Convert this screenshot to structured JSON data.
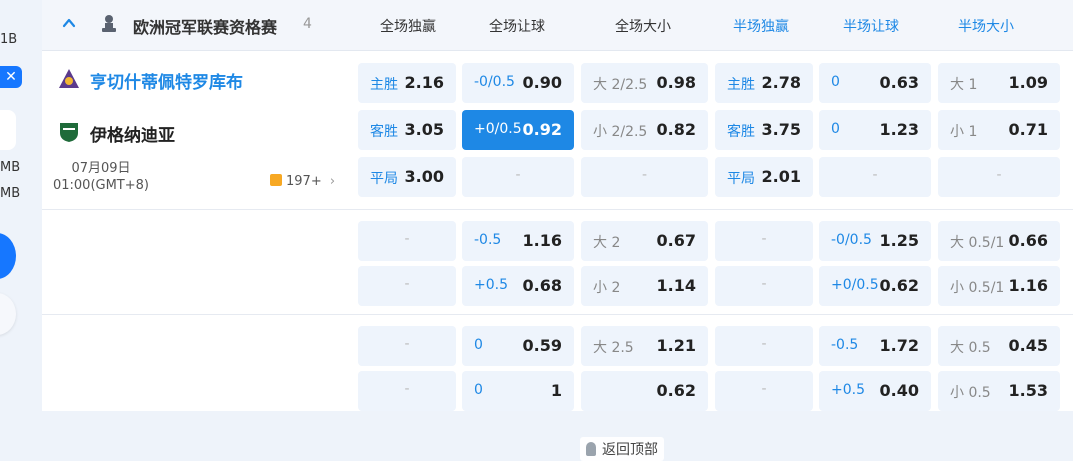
{
  "sidebar_fragments": [
    "1B",
    "MB",
    "MB"
  ],
  "header": {
    "league": "欧洲冠军联赛资格赛",
    "count": "4",
    "columns": [
      "全场独赢",
      "全场让球",
      "全场大小",
      "半场独赢",
      "半场让球",
      "半场大小"
    ]
  },
  "match": {
    "home": "亨切什蒂佩特罗库布",
    "away": "伊格纳迪亚",
    "date": "07月09日",
    "time": "01:00(GMT+8)",
    "more": "197+"
  },
  "rows": [
    [
      {
        "label": "主胜",
        "value": "2.16"
      },
      {
        "label": "-0/0.5",
        "value": "0.90"
      },
      {
        "label": "大 2/2.5",
        "value": "0.98",
        "grey": true
      },
      {
        "label": "主胜",
        "value": "2.78"
      },
      {
        "label": "0",
        "value": "0.63"
      },
      {
        "label": "大 1",
        "value": "1.09",
        "grey": true
      }
    ],
    [
      {
        "label": "客胜",
        "value": "3.05"
      },
      {
        "label": "+0/0.5",
        "value": "0.92",
        "highlight": true
      },
      {
        "label": "小 2/2.5",
        "value": "0.82",
        "grey": true
      },
      {
        "label": "客胜",
        "value": "3.75"
      },
      {
        "label": "0",
        "value": "1.23"
      },
      {
        "label": "小 1",
        "value": "0.71",
        "grey": true
      }
    ],
    [
      {
        "label": "平局",
        "value": "3.00"
      },
      {
        "dash": "-"
      },
      {
        "dash": "-"
      },
      {
        "label": "平局",
        "value": "2.01"
      },
      {
        "dash": "-"
      },
      {
        "dash": "-"
      }
    ],
    [
      {
        "dash": "-"
      },
      {
        "label": "-0.5",
        "value": "1.16"
      },
      {
        "label": "大 2",
        "value": "0.67",
        "grey": true
      },
      {
        "dash": "-"
      },
      {
        "label": "-0/0.5",
        "value": "1.25"
      },
      {
        "label": "大 0.5/1",
        "value": "0.66",
        "grey": true
      }
    ],
    [
      {
        "dash": "-"
      },
      {
        "label": "+0.5",
        "value": "0.68"
      },
      {
        "label": "小 2",
        "value": "1.14",
        "grey": true
      },
      {
        "dash": "-"
      },
      {
        "label": "+0/0.5",
        "value": "0.62"
      },
      {
        "label": "小 0.5/1",
        "value": "1.16",
        "grey": true
      }
    ],
    [
      {
        "dash": "-"
      },
      {
        "label": "0",
        "value": "0.59"
      },
      {
        "label": "大 2.5",
        "value": "1.21",
        "grey": true
      },
      {
        "dash": "-"
      },
      {
        "label": "-0.5",
        "value": "1.72"
      },
      {
        "label": "大 0.5",
        "value": "0.45",
        "grey": true
      }
    ],
    [
      {
        "dash": "-"
      },
      {
        "label": "0",
        "value": "1"
      },
      {
        "label": "",
        "value": "0.62",
        "grey": true
      },
      {
        "dash": "-"
      },
      {
        "label": "+0.5",
        "value": "0.40"
      },
      {
        "label": "小 0.5",
        "value": "1.53",
        "grey": true
      }
    ]
  ],
  "back_to_top": "返回顶部",
  "colors": {
    "accent": "#1e88e5",
    "highlight": "#1e88e5",
    "cell_bg": "#eef4fc",
    "page_bg": "#eef3fa"
  }
}
